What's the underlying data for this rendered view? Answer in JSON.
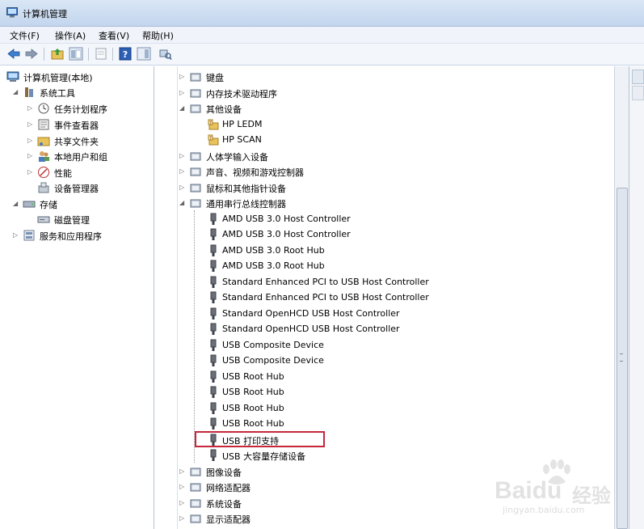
{
  "window": {
    "title": "计算机管理"
  },
  "menu": [
    "文件(F)",
    "操作(A)",
    "查看(V)",
    "帮助(H)"
  ],
  "left_tree": [
    {
      "label": "计算机管理(本地)",
      "arrow": "",
      "indent": 0
    },
    {
      "label": "系统工具",
      "arrow": "◢",
      "indent": 1
    },
    {
      "label": "任务计划程序",
      "arrow": "▷",
      "indent": 2
    },
    {
      "label": "事件查看器",
      "arrow": "▷",
      "indent": 2
    },
    {
      "label": "共享文件夹",
      "arrow": "▷",
      "indent": 2
    },
    {
      "label": "本地用户和组",
      "arrow": "▷",
      "indent": 2
    },
    {
      "label": "性能",
      "arrow": "▷",
      "indent": 2
    },
    {
      "label": "设备管理器",
      "arrow": "",
      "indent": 2
    },
    {
      "label": "存储",
      "arrow": "◢",
      "indent": 1
    },
    {
      "label": "磁盘管理",
      "arrow": "",
      "indent": 2
    },
    {
      "label": "服务和应用程序",
      "arrow": "▷",
      "indent": 1
    }
  ],
  "device_tree": [
    {
      "label": "键盘",
      "arrow": "▷",
      "level": 0
    },
    {
      "label": "内存技术驱动程序",
      "arrow": "▷",
      "level": 0
    },
    {
      "label": "其他设备",
      "arrow": "◢",
      "level": 0
    },
    {
      "label": "HP LEDM",
      "arrow": "",
      "level": 1
    },
    {
      "label": "HP SCAN",
      "arrow": "",
      "level": 1
    },
    {
      "label": "人体学输入设备",
      "arrow": "▷",
      "level": 0
    },
    {
      "label": "声音、视频和游戏控制器",
      "arrow": "▷",
      "level": 0
    },
    {
      "label": "鼠标和其他指针设备",
      "arrow": "▷",
      "level": 0
    },
    {
      "label": "通用串行总线控制器",
      "arrow": "◢",
      "level": 0
    },
    {
      "label": "AMD USB 3.0 Host Controller",
      "arrow": "",
      "level": 1
    },
    {
      "label": "AMD USB 3.0 Host Controller",
      "arrow": "",
      "level": 1
    },
    {
      "label": "AMD USB 3.0 Root Hub",
      "arrow": "",
      "level": 1
    },
    {
      "label": "AMD USB 3.0 Root Hub",
      "arrow": "",
      "level": 1
    },
    {
      "label": "Standard Enhanced PCI to USB Host Controller",
      "arrow": "",
      "level": 1
    },
    {
      "label": "Standard Enhanced PCI to USB Host Controller",
      "arrow": "",
      "level": 1
    },
    {
      "label": "Standard OpenHCD USB Host Controller",
      "arrow": "",
      "level": 1
    },
    {
      "label": "Standard OpenHCD USB Host Controller",
      "arrow": "",
      "level": 1
    },
    {
      "label": "USB Composite Device",
      "arrow": "",
      "level": 1
    },
    {
      "label": "USB Composite Device",
      "arrow": "",
      "level": 1
    },
    {
      "label": "USB Root Hub",
      "arrow": "",
      "level": 1
    },
    {
      "label": "USB Root Hub",
      "arrow": "",
      "level": 1
    },
    {
      "label": "USB Root Hub",
      "arrow": "",
      "level": 1
    },
    {
      "label": "USB Root Hub",
      "arrow": "",
      "level": 1
    },
    {
      "label": "USB 打印支持",
      "arrow": "",
      "level": 1
    },
    {
      "label": "USB 大容量存储设备",
      "arrow": "",
      "level": 1
    },
    {
      "label": "图像设备",
      "arrow": "▷",
      "level": 0
    },
    {
      "label": "网络适配器",
      "arrow": "▷",
      "level": 0
    },
    {
      "label": "系统设备",
      "arrow": "▷",
      "level": 0
    },
    {
      "label": "显示适配器",
      "arrow": "▷",
      "level": 0
    }
  ],
  "watermark": {
    "brand": "Baidu",
    "brand_cn": "经验",
    "url": "jingyan.baidu.com"
  },
  "colors": {
    "highlight": "#c4283a",
    "titlebar": "#c3d6ee"
  }
}
